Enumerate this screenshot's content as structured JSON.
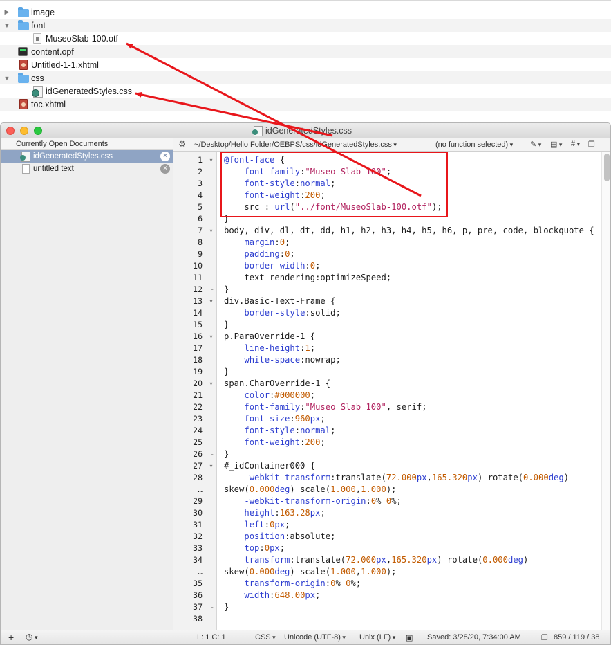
{
  "finder": {
    "rows": [
      {
        "name": "image",
        "kind": "folder",
        "state": "collapsed"
      },
      {
        "name": "font",
        "kind": "folder",
        "state": "expanded"
      },
      {
        "name": "MuseoSlab-100.otf",
        "kind": "font-file"
      },
      {
        "name": "content.opf",
        "kind": "opf-file"
      },
      {
        "name": "Untitled-1-1.xhtml",
        "kind": "xhtml-file"
      },
      {
        "name": "css",
        "kind": "folder",
        "state": "expanded"
      },
      {
        "name": "idGeneratedStyles.css",
        "kind": "css-file"
      },
      {
        "name": "toc.xhtml",
        "kind": "xhtml-file"
      }
    ]
  },
  "window": {
    "title": "idGeneratedStyles.css"
  },
  "sidebar": {
    "header": "Currently Open Documents",
    "items": [
      {
        "label": "idGeneratedStyles.css",
        "selected": true
      },
      {
        "label": "untitled text",
        "selected": false
      }
    ]
  },
  "navbar": {
    "path": "~/Desktop/Hello Folder/OEBPS/css/idGeneratedStyles.css",
    "function_menu": "(no function selected)",
    "pen_menu": "✎",
    "doc_menu": "▤",
    "hash_menu": "#",
    "page_icon": "❐"
  },
  "editor": {
    "lines": [
      {
        "n": "1",
        "fold": "▾",
        "html": "<span class='at'>@font-face</span> {"
      },
      {
        "n": "2",
        "fold": "",
        "html": "    <span class='k'>font-family</span>:<span class='s'>\"Museo Slab 100\"</span>;"
      },
      {
        "n": "3",
        "fold": "",
        "html": "    <span class='k'>font-style</span>:<span class='k'>normal</span>;"
      },
      {
        "n": "4",
        "fold": "",
        "html": "    <span class='k'>font-weight</span>:<span class='n'>200</span>;"
      },
      {
        "n": "5",
        "fold": "",
        "html": "    src : <span class='fn'>url</span>(<span class='s'>\"../font/MuseoSlab-100.otf\"</span>);"
      },
      {
        "n": "6",
        "fold": "└",
        "html": "}"
      },
      {
        "n": "7",
        "fold": "▾",
        "html": "body, div, dl, dt, dd, h1, h2, h3, h4, h5, h6, p, pre, code, blockquote {"
      },
      {
        "n": "8",
        "fold": "",
        "html": "    <span class='k'>margin</span>:<span class='n'>0</span>;"
      },
      {
        "n": "9",
        "fold": "",
        "html": "    <span class='k'>padding</span>:<span class='n'>0</span>;"
      },
      {
        "n": "10",
        "fold": "",
        "html": "    <span class='k'>border-width</span>:<span class='n'>0</span>;"
      },
      {
        "n": "11",
        "fold": "",
        "html": "    text-rendering:optimizeSpeed;"
      },
      {
        "n": "12",
        "fold": "└",
        "html": "}"
      },
      {
        "n": "13",
        "fold": "▾",
        "html": "div.Basic-Text-Frame {"
      },
      {
        "n": "14",
        "fold": "",
        "html": "    <span class='k'>border-style</span>:solid;"
      },
      {
        "n": "15",
        "fold": "└",
        "html": "}"
      },
      {
        "n": "16",
        "fold": "▾",
        "html": "p.ParaOverride-1 {"
      },
      {
        "n": "17",
        "fold": "",
        "html": "    <span class='k'>line-height</span>:<span class='n'>1</span>;"
      },
      {
        "n": "18",
        "fold": "",
        "html": "    <span class='k'>white-space</span>:nowrap;"
      },
      {
        "n": "19",
        "fold": "└",
        "html": "}"
      },
      {
        "n": "20",
        "fold": "▾",
        "html": "span.CharOverride-1 {"
      },
      {
        "n": "21",
        "fold": "",
        "html": "    <span class='k'>color</span>:<span class='n'>#000000</span>;"
      },
      {
        "n": "22",
        "fold": "",
        "html": "    <span class='k'>font-family</span>:<span class='s'>\"Museo Slab 100\"</span>, serif;"
      },
      {
        "n": "23",
        "fold": "",
        "html": "    <span class='k'>font-size</span>:<span class='n'>960</span><span class='k'>px</span>;"
      },
      {
        "n": "24",
        "fold": "",
        "html": "    <span class='k'>font-style</span>:<span class='k'>normal</span>;"
      },
      {
        "n": "25",
        "fold": "",
        "html": "    <span class='k'>font-weight</span>:<span class='n'>200</span>;"
      },
      {
        "n": "26",
        "fold": "└",
        "html": "}"
      },
      {
        "n": "27",
        "fold": "▾",
        "html": "#_idContainer000 {"
      },
      {
        "n": "28",
        "fold": "",
        "html": "    <span class='k'>-webkit-transform</span>:translate(<span class='n'>72.000</span><span class='k'>px</span>,<span class='n'>165.320</span><span class='k'>px</span>) rotate(<span class='n'>0.000</span><span class='k'>deg</span>)"
      },
      {
        "n": "…",
        "fold": "",
        "html": "skew(<span class='n'>0.000</span><span class='k'>deg</span>) scale(<span class='n'>1.000</span>,<span class='n'>1.000</span>);"
      },
      {
        "n": "29",
        "fold": "",
        "html": "    <span class='k'>-webkit-transform-origin</span>:<span class='n'>0</span>% <span class='n'>0</span>%;"
      },
      {
        "n": "30",
        "fold": "",
        "html": "    <span class='k'>height</span>:<span class='n'>163.28</span><span class='k'>px</span>;"
      },
      {
        "n": "31",
        "fold": "",
        "html": "    <span class='k'>left</span>:<span class='n'>0</span><span class='k'>px</span>;"
      },
      {
        "n": "32",
        "fold": "",
        "html": "    <span class='k'>position</span>:absolute;"
      },
      {
        "n": "33",
        "fold": "",
        "html": "    <span class='k'>top</span>:<span class='n'>0</span><span class='k'>px</span>;"
      },
      {
        "n": "34",
        "fold": "",
        "html": "    <span class='k'>transform</span>:translate(<span class='n'>72.000</span><span class='k'>px</span>,<span class='n'>165.320</span><span class='k'>px</span>) rotate(<span class='n'>0.000</span><span class='k'>deg</span>)"
      },
      {
        "n": "…",
        "fold": "",
        "html": "skew(<span class='n'>0.000</span><span class='k'>deg</span>) scale(<span class='n'>1.000</span>,<span class='n'>1.000</span>);"
      },
      {
        "n": "35",
        "fold": "",
        "html": "    <span class='k'>transform-origin</span>:<span class='n'>0</span>% <span class='n'>0</span>%;"
      },
      {
        "n": "36",
        "fold": "",
        "html": "    <span class='k'>width</span>:<span class='n'>648.00</span><span class='k'>px</span>;"
      },
      {
        "n": "37",
        "fold": "└",
        "html": "}"
      },
      {
        "n": "38",
        "fold": "",
        "html": ""
      }
    ]
  },
  "statusbar": {
    "add_button": "+",
    "history_button": "◷",
    "cursor": "L: 1 C: 1",
    "language": "CSS",
    "encoding": "Unicode (UTF-8)",
    "line_endings": "Unix (LF)",
    "lock_icon": "▣",
    "saved": "Saved: 3/28/20, 7:34:00 AM",
    "counts": "859 / 119 / 38"
  },
  "colors": {
    "annotation_red": "#e8161b",
    "selection_blue": "#8fa4c4",
    "folder_blue": "#69b2ee",
    "keyword_blue": "#2e3fd0",
    "string_magenta": "#b1225f",
    "number_orange": "#c25b00"
  }
}
